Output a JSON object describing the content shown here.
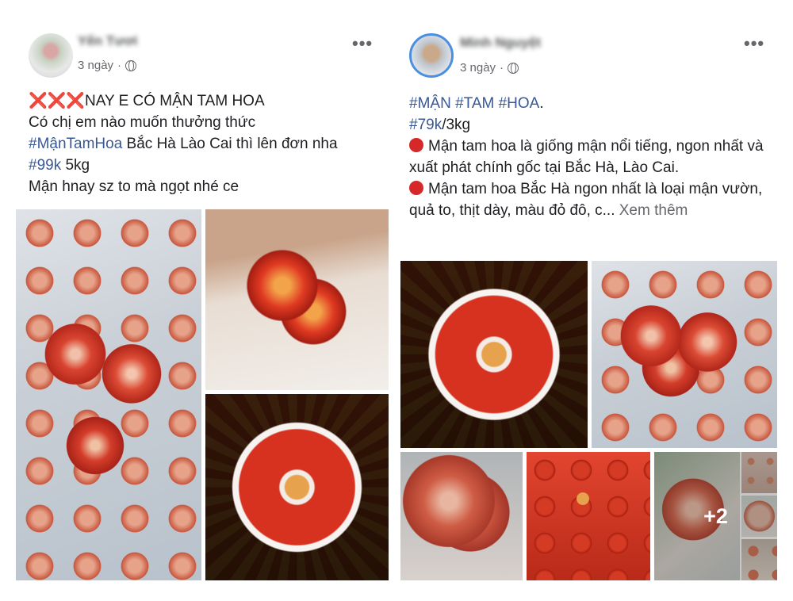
{
  "posts": [
    {
      "author": "Yến Tươi",
      "time": "3 ngày",
      "lines": [
        {
          "prefix": "❌❌❌",
          "text": "NAY E CÓ MẬN TAM HOA"
        },
        {
          "text": "Có chị em nào muốn thưởng thức"
        },
        {
          "hashtag": "#MậnTamHoa",
          "text": " Bắc Hà Lào Cai thì lên đơn nha"
        },
        {
          "hashtag": "#99k",
          "text": " 5kg"
        },
        {
          "text": "Mận hnay sz to mà ngọt  nhé ce"
        }
      ],
      "photos": [
        "plums-bag",
        "cut-plum",
        "plate"
      ]
    },
    {
      "author": "Minh Nguyệt",
      "time": "3 ngày",
      "lines": [
        {
          "hashtag": "#MẬN #TAM #HOA",
          "text": "."
        },
        {
          "hashtag": "#79k",
          "text": "/3kg"
        },
        {
          "bullet": "red-circle",
          "text": "Mận tam hoa là giống mận nổi tiếng, ngon nhất và xuất phát chính gốc tại Bắc Hà, Lào Cai."
        },
        {
          "bullet": "red-circle",
          "text": "Mận tam hoa Bắc Hà ngon nhất là loại mận vườn, quả to, thịt dày, màu đỏ đô, c...",
          "see_more": "Xem thêm"
        }
      ],
      "photos": [
        "plate",
        "plums-bag",
        "plum-close",
        "salt-plums",
        "plum-hand"
      ],
      "more_photos": "+2"
    }
  ],
  "icons": {
    "privacy": "globe-icon",
    "options": "more-horizontal-icon"
  },
  "colors": {
    "hashtag": "#385898",
    "meta": "#65676b",
    "red_x": "#e0245e",
    "red_dot": "#d62828",
    "avatar_ring": "#4a8fe0"
  }
}
